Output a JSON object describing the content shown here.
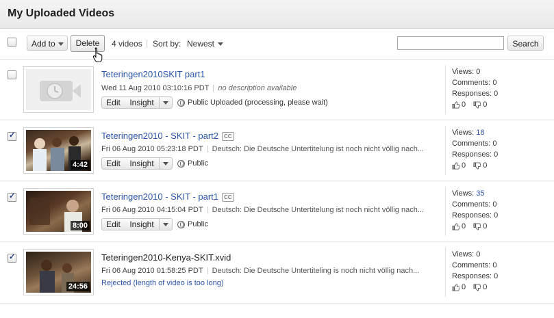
{
  "page_title": "My Uploaded Videos",
  "toolbar": {
    "add_to_label": "Add to",
    "delete_label": "Delete",
    "video_count": "4 videos",
    "sort_by_label": "Sort by:",
    "sort_value": "Newest",
    "search_value": "",
    "search_button": "Search"
  },
  "videos": [
    {
      "title": "Teteringen2010SKIT part1",
      "date": "Wed 11 Aug 2010 03:10:16 PDT",
      "description": "no description available",
      "edit_label": "Edit",
      "insight_label": "Insight",
      "status": "Public Uploaded (processing, please wait)",
      "checked": false,
      "views_label": "Views:",
      "views": "0",
      "comments_label": "Comments:",
      "comments": "0",
      "responses_label": "Responses:",
      "responses": "0",
      "likes": "0",
      "dislikes": "0"
    },
    {
      "title": "Teteringen2010 - SKIT - part2",
      "cc": "CC",
      "date": "Fri 06 Aug 2010 05:23:18 PDT",
      "description": "Deutsch: Die Deutsche Untertitelung ist noch nicht völlig nach...",
      "edit_label": "Edit",
      "insight_label": "Insight",
      "status": "Public",
      "duration": "4:42",
      "checked": true,
      "views_label": "Views:",
      "views": "18",
      "comments_label": "Comments:",
      "comments": "0",
      "responses_label": "Responses:",
      "responses": "0",
      "likes": "0",
      "dislikes": "0"
    },
    {
      "title": "Teteringen2010 - SKIT - part1",
      "cc": "CC",
      "date": "Fri 06 Aug 2010 04:15:04 PDT",
      "description": "Deutsch: Die Deutsche Untertitelung ist noch nicht völlig nach...",
      "edit_label": "Edit",
      "insight_label": "Insight",
      "status": "Public",
      "duration": "8:00",
      "checked": true,
      "views_label": "Views:",
      "views": "35",
      "comments_label": "Comments:",
      "comments": "0",
      "responses_label": "Responses:",
      "responses": "0",
      "likes": "0",
      "dislikes": "0"
    },
    {
      "title": "Teteringen2010-Kenya-SKIT.xvid",
      "date": "Fri 06 Aug 2010 01:58:25 PDT",
      "description": "Deutsch: Die Deutsche Untertiteling is noch nicht völlig nach...",
      "rejected": "Rejected (length of video is too long)",
      "duration": "24:56",
      "checked": true,
      "views_label": "Views:",
      "views": "0",
      "comments_label": "Comments:",
      "comments": "0",
      "responses_label": "Responses:",
      "responses": "0",
      "likes": "0",
      "dislikes": "0"
    }
  ]
}
